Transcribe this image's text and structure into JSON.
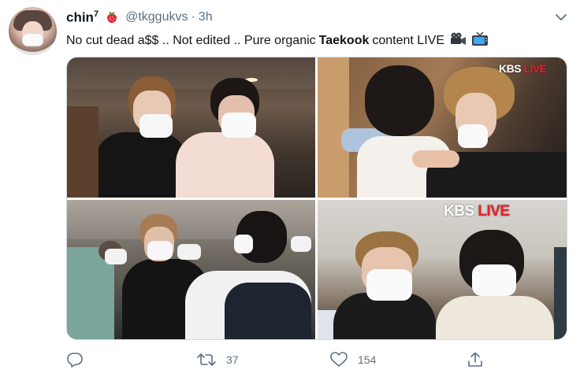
{
  "tweet": {
    "author": {
      "name": "chin",
      "name_sup": "7",
      "handle": "@tkggukvs",
      "separator": "·",
      "time": "3h",
      "badge_icon": "strawberry-emoji"
    },
    "text": {
      "part1": "No cut dead a$$ .. Not edited .. Pure organic",
      "bold": "Taekook",
      "part2": "content LIVE",
      "emojis": [
        "movie-camera-emoji",
        "television-emoji"
      ]
    },
    "media": {
      "watermarks": [
        {
          "brand": "KBS",
          "live": "LIVE"
        },
        {
          "brand": "KBS",
          "live": "LIVE"
        }
      ]
    },
    "actions": {
      "reply_icon": "reply-icon",
      "retweet_icon": "retweet-icon",
      "retweet_count": "37",
      "like_icon": "heart-icon",
      "like_count": "154",
      "share_icon": "share-icon"
    },
    "colors": {
      "text": "#0f1419",
      "secondary": "#5b7083",
      "border": "#cfd9de",
      "kbs_live": "#e8202a"
    }
  }
}
